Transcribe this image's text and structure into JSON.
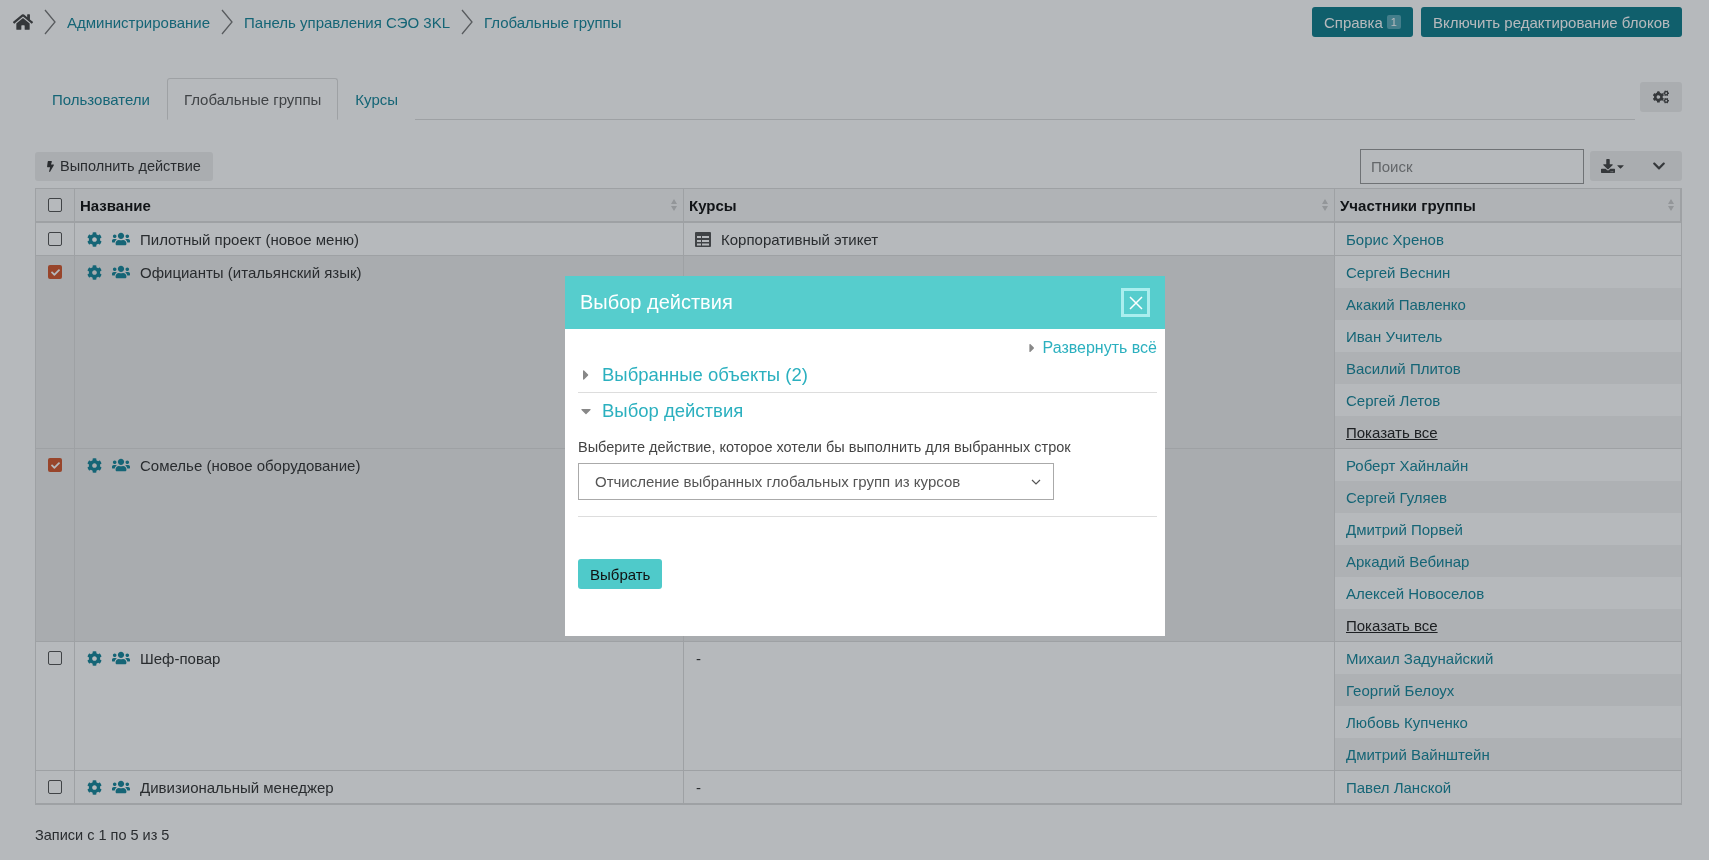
{
  "breadcrumbs": [
    "Администрирование",
    "Панель управления СЭО 3KL",
    "Глобальные группы"
  ],
  "header_buttons": [
    {
      "label": "Справка",
      "badge": "1"
    },
    {
      "label": "Включить редактирование блоков"
    }
  ],
  "tabs": [
    {
      "label": "Пользователи",
      "selected": false
    },
    {
      "label": "Глобальные группы",
      "selected": true
    },
    {
      "label": "Курсы",
      "selected": false
    }
  ],
  "toolbar": {
    "action_button": "Выполнить действие",
    "search": {
      "placeholder": "Поиск"
    }
  },
  "table": {
    "all_checked": false,
    "columns": [
      "Название",
      "Курсы",
      "Участники группы"
    ],
    "rows": [
      {
        "checked": false,
        "name": "Пилотный проект (новое меню)",
        "courses": [
          {
            "kind": "course",
            "title": "Корпоративный этикет"
          }
        ],
        "members": [
          "Борис Хренов"
        ]
      },
      {
        "checked": true,
        "name": "Официанты (итальянский язык)",
        "courses": [],
        "members": [
          "Сергей Веснин",
          "Акакий Павленко",
          "Иван Учитель",
          "Василий Плитов",
          "Сергей Летов"
        ],
        "more_link": "Показать все"
      },
      {
        "checked": true,
        "name": "Сомелье (новое оборудование)",
        "courses": [],
        "members": [
          "Роберт Хайнлайн",
          "Сергей Гуляев",
          "Дмитрий Порвей",
          "Аркадий Вебинар",
          "Алексей Новоселов"
        ],
        "more_link": "Показать все"
      },
      {
        "checked": false,
        "name": "Шеф-повар",
        "courses": [
          {
            "kind": "empty",
            "title": "-"
          }
        ],
        "members": [
          "Михаил Задунайский",
          "Георгий Белоух",
          "Любовь Купченко",
          "Дмитрий Вайнштейн"
        ]
      },
      {
        "checked": false,
        "name": "Дивизиональный менеджер",
        "courses": [
          {
            "kind": "empty",
            "title": "-"
          }
        ],
        "members": [
          "Павел Ланской"
        ]
      }
    ]
  },
  "footer": "Записи с 1 по 5 из 5",
  "modal": {
    "title": "Выбор действия",
    "expand_all": "Развернуть всё",
    "sections": [
      {
        "title": "Выбранные объекты (2)",
        "expanded": false
      },
      {
        "title": "Выбор действия",
        "expanded": true
      }
    ],
    "description": "Выберите действие, которое хотели бы выполнить для выбранных строк",
    "select_value": "Отчисление выбранных глобальных групп из курсов",
    "submit": "Выбрать"
  }
}
